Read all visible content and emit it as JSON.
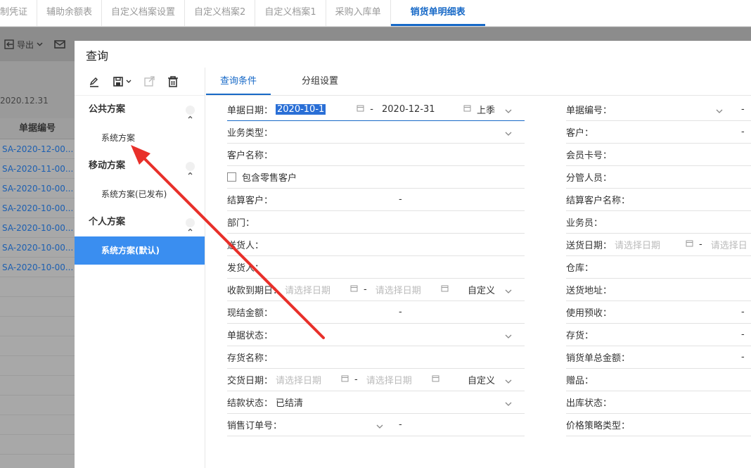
{
  "tabs": [
    "制凭证",
    "辅助余额表",
    "自定义档案设置",
    "自定义档案2",
    "自定义档案1",
    "采购入库单",
    "销货单明细表"
  ],
  "toolbar": {
    "export_label": "导出"
  },
  "background": {
    "date": "2020.12.31",
    "column_header": "单据编号",
    "rows": [
      "SA-2020-12-00...",
      "SA-2020-11-00...",
      "SA-2020-10-00...",
      "SA-2020-10-00...",
      "SA-2020-10-00...",
      "SA-2020-10-00...",
      "SA-2020-10-00..."
    ]
  },
  "dialog": {
    "title": "查询",
    "groups": [
      {
        "label": "公共方案",
        "schemes": [
          "系统方案"
        ]
      },
      {
        "label": "移动方案",
        "schemes": [
          "系统方案(已发布)"
        ]
      },
      {
        "label": "个人方案",
        "schemes": [
          "系统方案(默认)"
        ]
      }
    ],
    "tabs": [
      "查询条件",
      "分组设置"
    ],
    "left_fields": [
      {
        "label": "单据日期：",
        "value": "2020-10-1",
        "value2": "2020-12-31",
        "tail": "上季"
      },
      {
        "label": "业务类型：",
        "value": ""
      },
      {
        "label": "客户名称：",
        "value": ""
      },
      {
        "label": "包含零售客户",
        "value": ""
      },
      {
        "label": "结算客户：",
        "value": "-"
      },
      {
        "label": "部门：",
        "value": ""
      },
      {
        "label": "送货人：",
        "value": ""
      },
      {
        "label": "发货人：",
        "value": ""
      },
      {
        "label": "收款到期日：",
        "value": "请选择日期",
        "value2": "请选择日期",
        "tail": "自定义"
      },
      {
        "label": "现结金额：",
        "value": "-"
      },
      {
        "label": "单据状态：",
        "value": ""
      },
      {
        "label": "存货名称：",
        "value": ""
      },
      {
        "label": "交货日期：",
        "value": "请选择日期",
        "value2": "请选择日期",
        "tail": "自定义"
      },
      {
        "label": "结款状态：",
        "value": "已结清"
      },
      {
        "label": "销售订单号：",
        "value": "-"
      }
    ],
    "right_fields": [
      {
        "label": "单据编号：",
        "value": "-"
      },
      {
        "label": "客户：",
        "value": "-"
      },
      {
        "label": "会员卡号：",
        "value": ""
      },
      {
        "label": "分管人员：",
        "value": ""
      },
      {
        "label": "结算客户名称：",
        "value": ""
      },
      {
        "label": "业务员：",
        "value": ""
      },
      {
        "label": "送货日期：",
        "value": "请选择日期",
        "value2": "请选择日"
      },
      {
        "label": "仓库：",
        "value": ""
      },
      {
        "label": "送货地址：",
        "value": ""
      },
      {
        "label": "使用预收：",
        "value": "-"
      },
      {
        "label": "存货：",
        "value": "-"
      },
      {
        "label": "销货单总金额：",
        "value": "-"
      },
      {
        "label": "赠品：",
        "value": ""
      },
      {
        "label": "出库状态：",
        "value": ""
      },
      {
        "label": "价格策略类型：",
        "value": ""
      }
    ]
  },
  "colors": {
    "accent": "#1769c7",
    "selected": "#3a8ef0",
    "arrow": "#e8302a"
  }
}
